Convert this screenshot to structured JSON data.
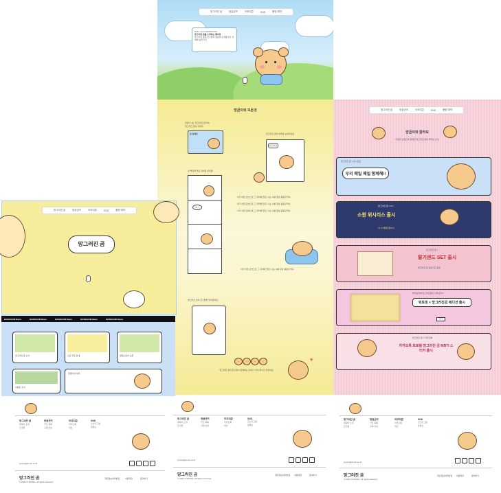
{
  "nav": {
    "items": [
      "망그러진 곰",
      "망곰굿즈",
      "이모티콘",
      "SNS",
      "춤방 예약"
    ]
  },
  "hero": {
    "card_line1": "Hello. we're MANGGOM",
    "card_line2": "망그러진 곰을 소개하는 페이지",
    "card_desc": "망그러진 곰과 친구들의 일상을 소개합니다. 자세히 보러 가기"
  },
  "intro": {
    "title": "망곰이의 모든것",
    "text1": "안녕? 나는 '망그러진 곰'이야.",
    "text2": "망그러진 곰이 되었어.",
    "profile_title": "곰 정체표",
    "comic_caption": "난 좋은게 많은 귀여운 곰이랑!",
    "story": "너가 어떤 모습으로 그 자리에 있던, 나는 너를 항상 응원할거야.",
    "side_text": "망그러진 곰의 하루를 보여주세요",
    "bubble1": "23.7",
    "bubble2": "망그러진",
    "comic2_caption": "망그러진 곰이 친구들을 찾아볼래요!",
    "ending": "망그러진 곰과 친구들이 함께하는 이야기, 아직 끝나지 않았어요."
  },
  "collab": {
    "title": "망곰이와 콜라보",
    "subtitle": "다양한 브랜드와 함께한 망그러진 곰의 콜라보 소식",
    "banners": [
      {
        "brand": "망그러진 곰 × 유니코르",
        "headline": "우리 매일 매일 함께해!!",
        "sub": ""
      },
      {
        "brand": "망그러진 곰 × CU",
        "headline": "소원 위시리스 출시",
        "sub": "11 & 6월일 정12시"
      },
      {
        "brand": "망그러진 곰 ×",
        "headline": "딸기샌드 SET 출시",
        "sub": "망그러진 곰 포토카드 증정"
      },
      {
        "brand": "올리브영에 망그러진곰이 나타났다?!",
        "headline": "럭토핏 × 망그러진곰 에디션 출시",
        "sub": "???"
      },
      {
        "brand": "망그러진 곰 × 카카오톡",
        "headline": "카카오톡 프로필 망그러진 곰 MBTI 스티커 출시",
        "sub": ""
      }
    ]
  },
  "yellow_hero": {
    "title": "망그러진 곰"
  },
  "news": {
    "label": "MANGGOM News",
    "repeat": [
      "MANGGOM News",
      "MANGGOM News",
      "MANGGOM News",
      "MANGGOM News",
      "MANGGOM News"
    ],
    "cards": [
      "망그러진 곰 소식",
      "신규 굿즈 안내",
      "팝업스토어 오픈",
      "이벤트 소식",
      "망곰이의 하루"
    ]
  },
  "footer": {
    "columns": [
      {
        "title": "망그러진 곰",
        "items": [
          "캐릭터 소개",
          "친구들"
        ]
      },
      {
        "title": "망곰굿즈",
        "items": [
          "굿즈 목록",
          "구매 안내"
        ]
      },
      {
        "title": "이모티콘",
        "items": [
          "카카오톡",
          "라인"
        ]
      },
      {
        "title": "SNS",
        "items": [
          "인스타그램",
          "유튜브"
        ]
      }
    ],
    "email": "yumin@yumin.co.kr",
    "logo": "망그러진 곰",
    "copyright": "© 2024 YURANG. All rights reserved.",
    "links": [
      "개인정보처리방침",
      "이용약관",
      "문의하기"
    ]
  },
  "icons": [
    "blog-icon",
    "instagram-icon",
    "youtube-icon",
    "x-icon",
    "scroll-mouse-icon",
    "heart-icon"
  ],
  "colors": {
    "sky": "#bfe3f8",
    "grass": "#9fd27a",
    "yellow": "#f7ef9e",
    "pink": "#f7d3dc",
    "lightblue": "#c9e0f7",
    "navy": "#2e3a6b",
    "bear": "#f6c98d"
  }
}
